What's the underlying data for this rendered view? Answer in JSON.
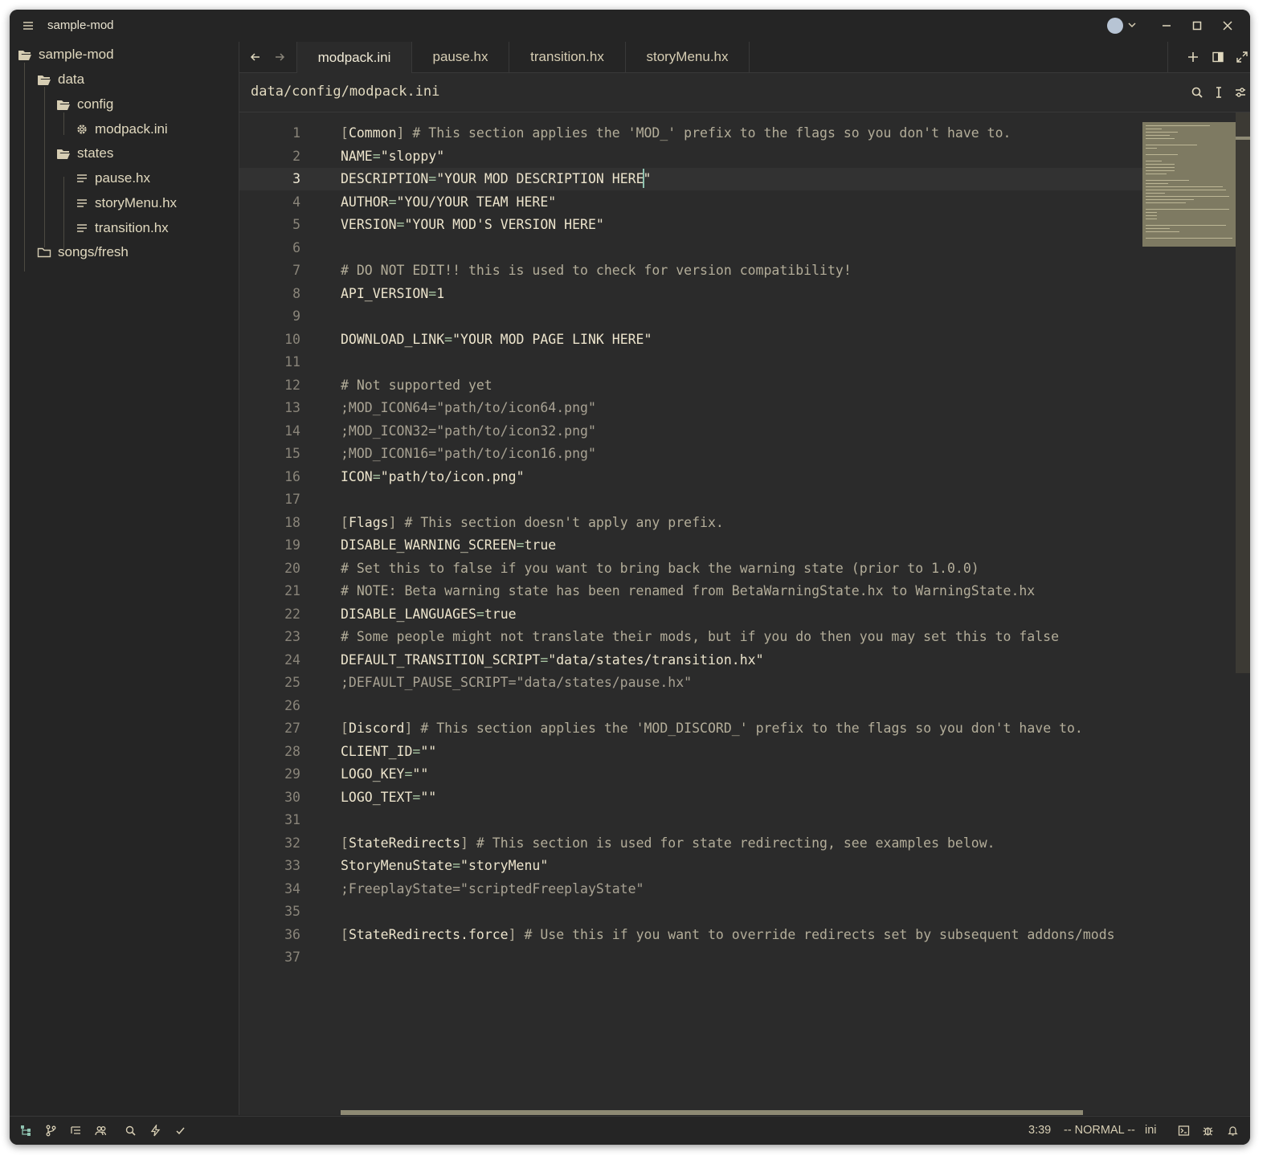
{
  "window": {
    "title": "sample-mod"
  },
  "titlebar_icons": [
    "menu-icon",
    "user-avatar",
    "chevron-down-icon",
    "minimize-icon",
    "maximize-icon",
    "close-icon"
  ],
  "sidebar": {
    "items": [
      {
        "label": "sample-mod",
        "icon": "folder-open-icon"
      },
      {
        "label": "data",
        "icon": "folder-open-icon"
      },
      {
        "label": "config",
        "icon": "folder-open-icon"
      },
      {
        "label": "modpack.ini",
        "icon": "gear-icon"
      },
      {
        "label": "states",
        "icon": "folder-open-icon"
      },
      {
        "label": "pause.hx",
        "icon": "file-text-icon"
      },
      {
        "label": "storyMenu.hx",
        "icon": "file-text-icon"
      },
      {
        "label": "transition.hx",
        "icon": "file-text-icon"
      },
      {
        "label": "songs/fresh",
        "icon": "folder-closed-icon"
      }
    ]
  },
  "tabs": [
    {
      "label": "modpack.ini",
      "active": true
    },
    {
      "label": "pause.hx",
      "active": false
    },
    {
      "label": "transition.hx",
      "active": false
    },
    {
      "label": "storyMenu.hx",
      "active": false
    }
  ],
  "breadcrumb": {
    "path": "data/config/modpack.ini"
  },
  "editor": {
    "current_line": 3,
    "lines": [
      {
        "n": "1",
        "text": "[Common] # This section applies the 'MOD_' prefix to the flags so you don't have to."
      },
      {
        "n": "2",
        "text": "NAME=\"sloppy\""
      },
      {
        "n": "3",
        "text": "DESCRIPTION=\"YOUR MOD DESCRIPTION HERE\""
      },
      {
        "n": "4",
        "text": "AUTHOR=\"YOU/YOUR TEAM HERE\""
      },
      {
        "n": "5",
        "text": "VERSION=\"YOUR MOD'S VERSION HERE\""
      },
      {
        "n": "6",
        "text": ""
      },
      {
        "n": "7",
        "text": "# DO NOT EDIT!! this is used to check for version compatibility!"
      },
      {
        "n": "8",
        "text": "API_VERSION=1"
      },
      {
        "n": "9",
        "text": ""
      },
      {
        "n": "10",
        "text": "DOWNLOAD_LINK=\"YOUR MOD PAGE LINK HERE\""
      },
      {
        "n": "11",
        "text": ""
      },
      {
        "n": "12",
        "text": "# Not supported yet"
      },
      {
        "n": "13",
        "text": ";MOD_ICON64=\"path/to/icon64.png\""
      },
      {
        "n": "14",
        "text": ";MOD_ICON32=\"path/to/icon32.png\""
      },
      {
        "n": "15",
        "text": ";MOD_ICON16=\"path/to/icon16.png\""
      },
      {
        "n": "16",
        "text": "ICON=\"path/to/icon.png\""
      },
      {
        "n": "17",
        "text": ""
      },
      {
        "n": "18",
        "text": "[Flags] # This section doesn't apply any prefix."
      },
      {
        "n": "19",
        "text": "DISABLE_WARNING_SCREEN=true"
      },
      {
        "n": "20",
        "text": "# Set this to false if you want to bring back the warning state (prior to 1.0.0)"
      },
      {
        "n": "21",
        "text": "# NOTE: Beta warning state has been renamed from BetaWarningState.hx to WarningState.hx"
      },
      {
        "n": "22",
        "text": "DISABLE_LANGUAGES=true"
      },
      {
        "n": "23",
        "text": "# Some people might not translate their mods, but if you do then you may set this to false"
      },
      {
        "n": "24",
        "text": "DEFAULT_TRANSITION_SCRIPT=\"data/states/transition.hx\""
      },
      {
        "n": "25",
        "text": ";DEFAULT_PAUSE_SCRIPT=\"data/states/pause.hx\""
      },
      {
        "n": "26",
        "text": ""
      },
      {
        "n": "27",
        "text": "[Discord] # This section applies the 'MOD_DISCORD_' prefix to the flags so you don't have to."
      },
      {
        "n": "28",
        "text": "CLIENT_ID=\"\""
      },
      {
        "n": "29",
        "text": "LOGO_KEY=\"\""
      },
      {
        "n": "30",
        "text": "LOGO_TEXT=\"\""
      },
      {
        "n": "31",
        "text": ""
      },
      {
        "n": "32",
        "text": "[StateRedirects] # This section is used for state redirecting, see examples below."
      },
      {
        "n": "33",
        "text": "StoryMenuState=\"storyMenu\""
      },
      {
        "n": "34",
        "text": ";FreeplayState=\"scriptedFreeplayState\""
      },
      {
        "n": "35",
        "text": ""
      },
      {
        "n": "36",
        "text": "[StateRedirects.force] # Use this if you want to override redirects set by subsequent addons/mods"
      },
      {
        "n": "37",
        "text": ""
      }
    ]
  },
  "statusbar": {
    "position": "3:39",
    "mode": "-- NORMAL --",
    "language": "ini"
  },
  "colors": {
    "background": "#2b2b2b",
    "panel": "#252525",
    "text": "#ece4cc",
    "comment": "#b3ad99",
    "punct": "#a7c4a2",
    "accent": "#8ec2b0",
    "minimap": "#7e7a62"
  }
}
